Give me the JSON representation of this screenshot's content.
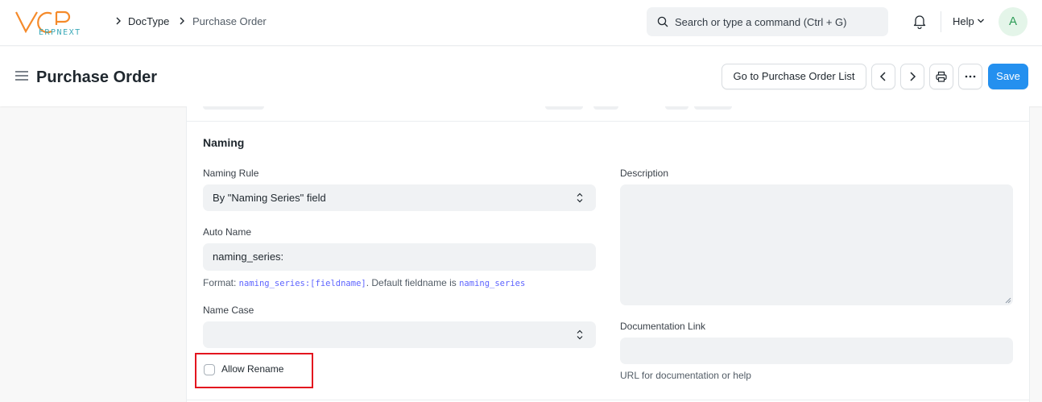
{
  "navbar": {
    "logo_alt": "VCP ERPNEXT",
    "breadcrumbs": [
      "DocType",
      "Purchase Order"
    ],
    "search": {
      "placeholder": "Search or type a command (Ctrl + G)"
    },
    "help_label": "Help",
    "avatar_initial": "A"
  },
  "pagehead": {
    "title": "Purchase Order",
    "go_to_list_label": "Go to Purchase Order List",
    "save_label": "Save"
  },
  "section": {
    "title": "Naming",
    "naming_rule": {
      "label": "Naming Rule",
      "value": "By \"Naming Series\" field"
    },
    "auto_name": {
      "label": "Auto Name",
      "value": "naming_series:",
      "help_prefix": "Format: ",
      "help_code1": "naming_series:[fieldname]",
      "help_mid": ". Default fieldname is ",
      "help_code2": "naming_series"
    },
    "name_case": {
      "label": "Name Case",
      "value": ""
    },
    "allow_rename": {
      "label": "Allow Rename",
      "checked": false
    },
    "description": {
      "label": "Description",
      "value": ""
    },
    "documentation_link": {
      "label": "Documentation Link",
      "value": "",
      "help": "URL for documentation or help"
    }
  },
  "colors": {
    "primary": "#2490ef",
    "highlight": "#e3151f",
    "avatar_bg": "#e4f5e9",
    "avatar_fg": "#2f9d58"
  }
}
